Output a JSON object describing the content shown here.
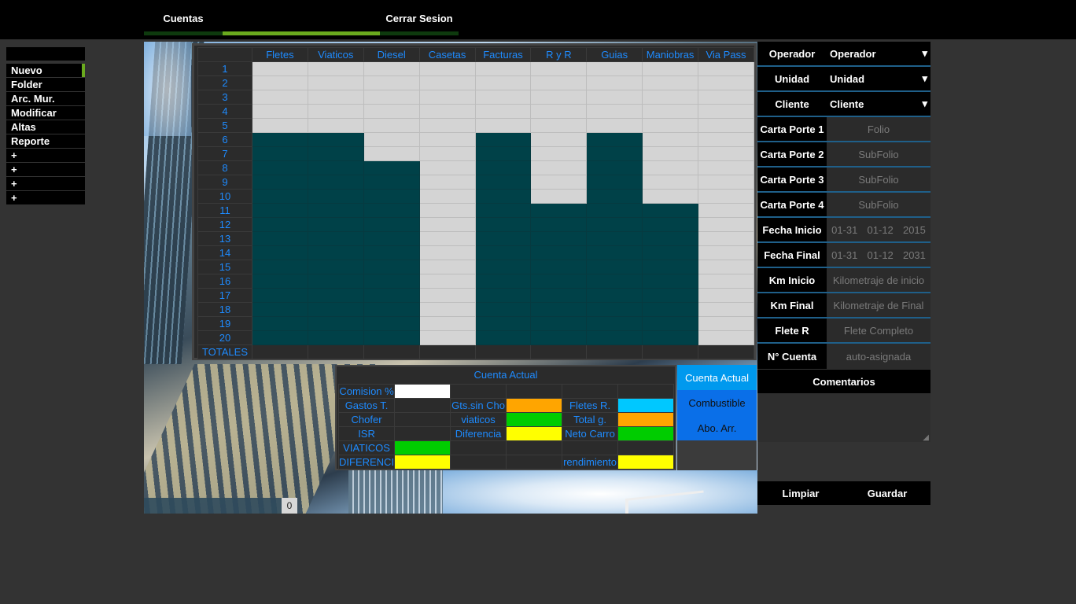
{
  "topnav": {
    "cuentas": "Cuentas",
    "cerrar": "Cerrar Sesion"
  },
  "sidebar": {
    "items": [
      {
        "label": "Nuevo"
      },
      {
        "label": "Folder"
      },
      {
        "label": "Arc. Mur."
      },
      {
        "label": "Modificar"
      },
      {
        "label": "Altas"
      },
      {
        "label": "Reporte"
      },
      {
        "label": "+"
      },
      {
        "label": "+"
      },
      {
        "label": "+"
      },
      {
        "label": "+"
      }
    ]
  },
  "grid": {
    "columns": [
      "Fletes",
      "Viaticos",
      "Diesel",
      "Casetas",
      "Facturas",
      "R y R",
      "Guias",
      "Maniobras",
      "Via Pass"
    ],
    "rows": [
      "1",
      "2",
      "3",
      "4",
      "5",
      "6",
      "7",
      "8",
      "9",
      "10",
      "11",
      "12",
      "13",
      "14",
      "15",
      "16",
      "17",
      "18",
      "19",
      "20"
    ],
    "totals_label": "TOTALES"
  },
  "summary": {
    "caption": "Cuenta Actual",
    "rows": [
      [
        "Comision %",
        "",
        "",
        "",
        "",
        ""
      ],
      [
        "Gastos T.",
        "",
        "Gts.sin Cho",
        "",
        "Fletes R.",
        ""
      ],
      [
        "Chofer",
        "",
        "viaticos",
        "",
        "Total g.",
        ""
      ],
      [
        "ISR",
        "",
        "Diferencia",
        "",
        "Neto Carro",
        ""
      ],
      [
        "VIATICOS",
        "",
        "",
        "",
        "",
        ""
      ],
      [
        "DIFERENCI",
        "",
        "",
        "",
        "rendimiento",
        ""
      ]
    ]
  },
  "tabs": {
    "cuenta_actual": "Cuenta Actual",
    "combustible": "Combustible",
    "abo_arr": "Abo. Arr."
  },
  "form": {
    "operador_label": "Operador",
    "operador_value": "Operador",
    "unidad_label": "Unidad",
    "unidad_value": "Unidad",
    "cliente_label": "Cliente",
    "cliente_value": "Cliente",
    "cp1_label": "Carta Porte 1",
    "cp1_placeholder": "Folio",
    "cp2_label": "Carta Porte 2",
    "cp2_placeholder": "SubFolio",
    "cp3_label": "Carta Porte 3",
    "cp3_placeholder": "SubFolio",
    "cp4_label": "Carta Porte 4",
    "cp4_placeholder": "SubFolio",
    "fecha_inicio_label": "Fecha Inicio",
    "fecha_inicio": [
      "01-31",
      "01-12",
      "2015"
    ],
    "fecha_final_label": "Fecha Final",
    "fecha_final": [
      "01-31",
      "01-12",
      "2031"
    ],
    "km_inicio_label": "Km Inicio",
    "km_inicio_placeholder": "Kilometraje de inicio",
    "km_final_label": "Km Final",
    "km_final_placeholder": "Kilometraje de Final",
    "flete_label": "Flete R",
    "flete_placeholder": "Flete Completo",
    "cuenta_label": "N° Cuenta",
    "cuenta_placeholder": "auto-asignada",
    "comentarios_label": "Comentarios"
  },
  "actions": {
    "limpiar": "Limpiar",
    "guardar": "Guardar"
  },
  "footer_counter": "0",
  "colors": {
    "accent": "#1e8bff",
    "teal": "#004148",
    "nav_green": "#6aaa1e",
    "tab_blue": "#0a6fe8",
    "tab_active": "#0099ee"
  }
}
